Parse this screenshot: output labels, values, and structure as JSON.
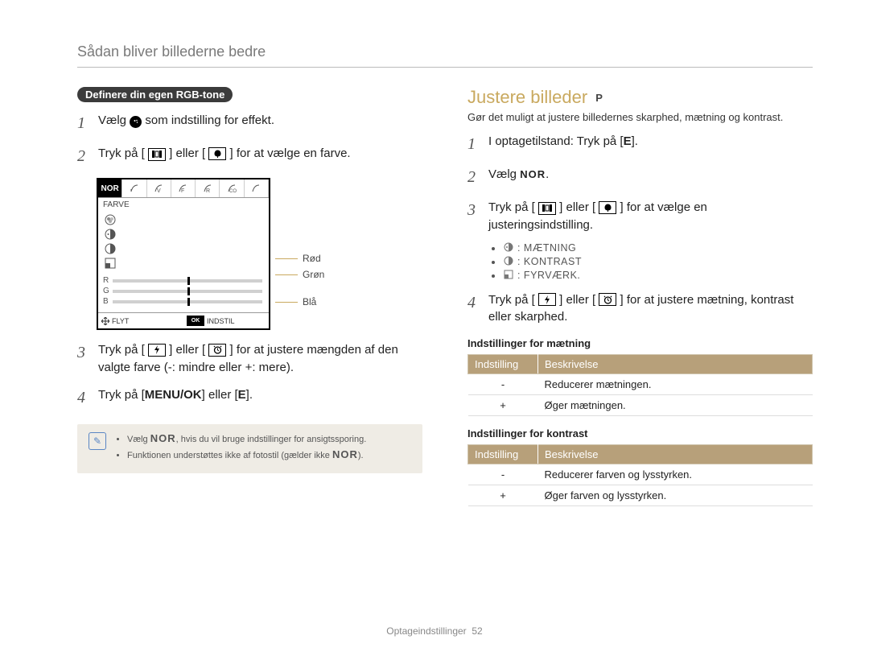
{
  "header": {
    "title": "Sådan bliver billederne bedre"
  },
  "left": {
    "lozenge": "Definere din egen RGB-tone",
    "steps": {
      "s1_a": "Vælg ",
      "s1_b": " som indstilling for effekt.",
      "s2_a": "Tryk på [",
      "s2_b": "] eller [",
      "s2_c": "] for at vælge en farve.",
      "s3_a": "Tryk på [",
      "s3_b": "] eller [",
      "s3_c": "] for at justere mængden af den valgte farve (-: mindre eller +: mere).",
      "s4_a": "Tryk på [",
      "s4_b": "MENU/OK",
      "s4_c": "] eller [",
      "s4_d": "E",
      "s4_e": "]."
    },
    "lcd": {
      "tab_first": "NOR",
      "subheader": "FARVE",
      "rgb": {
        "r": "R",
        "g": "G",
        "b": "B"
      },
      "footer_flyt": "FLYT",
      "footer_ok": "OK",
      "footer_indstil": "INDSTIL"
    },
    "labels": {
      "red": "Rød",
      "green": "Grøn",
      "blue": "Blå"
    },
    "note1_a": "Vælg ",
    "note1_nor": "NOR",
    "note1_b": ", hvis du vil bruge indstillinger for ansigtssporing.",
    "note2_a": "Funktionen understøttes ikke af fotostil (gælder ikke ",
    "note2_nor": "NOR",
    "note2_b": ")."
  },
  "right": {
    "title": "Justere billeder",
    "mode": "P",
    "intro": "Gør det muligt at justere billedernes skarphed, mætning og kontrast.",
    "steps": {
      "s1_a": "I optagetilstand: Tryk på [",
      "s1_b": "E",
      "s1_c": "].",
      "s2_a": "Vælg ",
      "s2_nor": "NOR",
      "s2_b": ".",
      "s3_a": "Tryk på [",
      "s3_b": "] eller [",
      "s3_c": "] for at vælge en justeringsindstilling.",
      "s4_a": "Tryk på [",
      "s4_b": "] eller [",
      "s4_c": "] for at justere mætning, kontrast eller skarphed."
    },
    "bullets": {
      "b1": ": MÆTNING",
      "b2": ": KONTRAST",
      "b3": ": FYRVÆRK."
    },
    "sat": {
      "h": "Indstillinger for mætning",
      "th1": "Indstilling",
      "th2": "Beskrivelse",
      "r1c1": "-",
      "r1c2": "Reducerer mætningen.",
      "r2c1": "+",
      "r2c2": "Øger mætningen."
    },
    "con": {
      "h": "Indstillinger for kontrast",
      "th1": "Indstilling",
      "th2": "Beskrivelse",
      "r1c1": "-",
      "r1c2": "Reducerer farven og lysstyrken.",
      "r2c1": "+",
      "r2c2": "Øger farven og lysstyrken."
    }
  },
  "footer": {
    "section": "Optageindstillinger",
    "page": "52"
  }
}
